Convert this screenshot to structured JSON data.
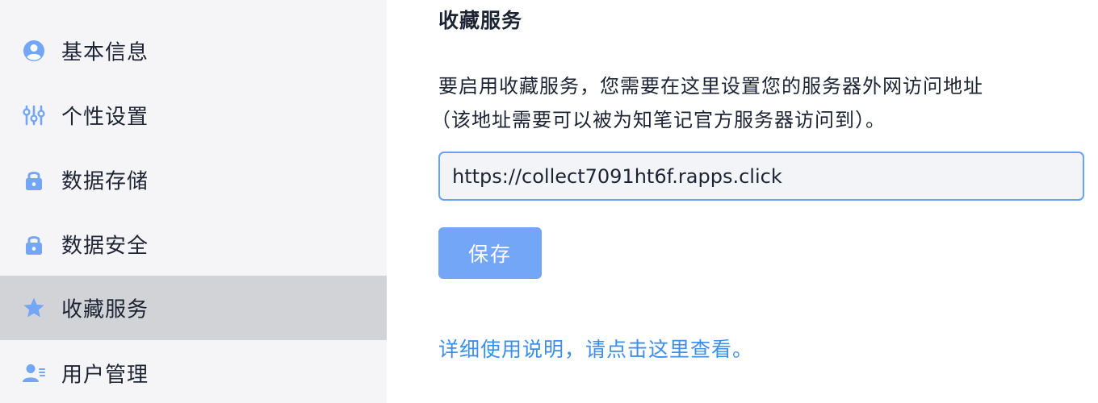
{
  "sidebar": {
    "items": [
      {
        "label": "基本信息",
        "icon": "user-circle-icon",
        "active": false
      },
      {
        "label": "个性设置",
        "icon": "sliders-icon",
        "active": false
      },
      {
        "label": "数据存储",
        "icon": "lock-icon",
        "active": false
      },
      {
        "label": "数据安全",
        "icon": "lock-icon",
        "active": false
      },
      {
        "label": "收藏服务",
        "icon": "star-icon",
        "active": true
      },
      {
        "label": "用户管理",
        "icon": "user-manage-icon",
        "active": false
      }
    ]
  },
  "main": {
    "title": "收藏服务",
    "description_line1": "要启用收藏服务，您需要在这里设置您的服务器外网访问地址",
    "description_line2": "（该地址需要可以被为知笔记官方服务器访问到）。",
    "url_value": "https://collect7091ht6f.rapps.click",
    "save_label": "保存",
    "help_link": "详细使用说明，请点击这里查看。"
  },
  "colors": {
    "icon": "#73a6f7",
    "sidebar_bg": "#f5f5f7",
    "active_bg": "#d2d3d6",
    "button_bg": "#73a6f7",
    "link": "#3d8ee8",
    "text": "#1c2333"
  }
}
